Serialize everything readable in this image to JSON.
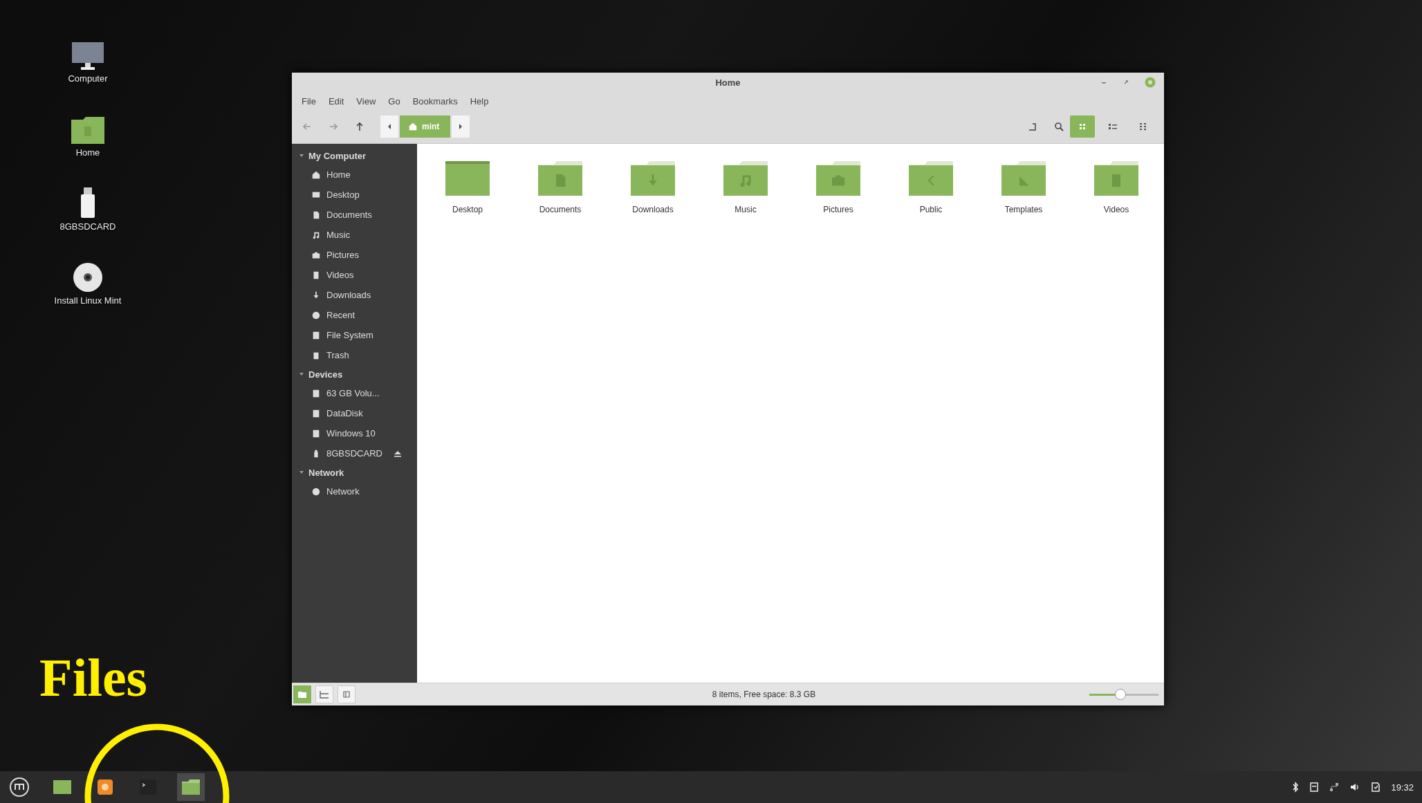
{
  "desktop_icons": [
    {
      "label": "Computer",
      "kind": "monitor"
    },
    {
      "label": "Home",
      "kind": "folder"
    },
    {
      "label": "8GBSDCARD",
      "kind": "usb"
    },
    {
      "label": "Install Linux Mint",
      "kind": "disc"
    }
  ],
  "window": {
    "title": "Home",
    "menu": [
      "File",
      "Edit",
      "View",
      "Go",
      "Bookmarks",
      "Help"
    ],
    "breadcrumb": "mint",
    "views": [
      {
        "kind": "icons",
        "selected": true
      },
      {
        "kind": "compact",
        "selected": false
      },
      {
        "kind": "list",
        "selected": false
      }
    ]
  },
  "sidebar": {
    "sections": [
      {
        "title": "My Computer",
        "expanded": true,
        "items": [
          {
            "label": "Home",
            "kind": "home",
            "ejectable": false
          },
          {
            "label": "Desktop",
            "kind": "desktop",
            "ejectable": false
          },
          {
            "label": "Documents",
            "kind": "document",
            "ejectable": false
          },
          {
            "label": "Music",
            "kind": "music",
            "ejectable": false
          },
          {
            "label": "Pictures",
            "kind": "camera",
            "ejectable": false
          },
          {
            "label": "Videos",
            "kind": "film",
            "ejectable": false
          },
          {
            "label": "Downloads",
            "kind": "download",
            "ejectable": false
          },
          {
            "label": "Recent",
            "kind": "clock",
            "ejectable": false
          },
          {
            "label": "File System",
            "kind": "drive",
            "ejectable": false
          },
          {
            "label": "Trash",
            "kind": "trash",
            "ejectable": false
          }
        ]
      },
      {
        "title": "Devices",
        "expanded": true,
        "items": [
          {
            "label": "63 GB Volu...",
            "kind": "drive",
            "ejectable": false
          },
          {
            "label": "DataDisk",
            "kind": "drive",
            "ejectable": false
          },
          {
            "label": "Windows 10",
            "kind": "drive",
            "ejectable": false
          },
          {
            "label": "8GBSDCARD",
            "kind": "usb",
            "ejectable": true
          }
        ]
      },
      {
        "title": "Network",
        "expanded": true,
        "items": [
          {
            "label": "Network",
            "kind": "globe",
            "ejectable": false
          }
        ]
      }
    ]
  },
  "folders": [
    {
      "label": "Desktop",
      "kind": "desktop"
    },
    {
      "label": "Documents",
      "kind": "document"
    },
    {
      "label": "Downloads",
      "kind": "download"
    },
    {
      "label": "Music",
      "kind": "music"
    },
    {
      "label": "Pictures",
      "kind": "camera"
    },
    {
      "label": "Public",
      "kind": "share"
    },
    {
      "label": "Templates",
      "kind": "template"
    },
    {
      "label": "Videos",
      "kind": "film"
    }
  ],
  "status_bar": {
    "panes": [
      {
        "kind": "places",
        "selected": true
      },
      {
        "kind": "tree",
        "selected": false
      },
      {
        "kind": "hide",
        "selected": false
      }
    ],
    "text": "8 items, Free space: 8.3 GB",
    "zoom": {
      "level": 0.45
    }
  },
  "annotation": {
    "label": "Files"
  },
  "taskbar": {
    "items": [
      {
        "kind": "menu",
        "selected": false
      },
      {
        "kind": "desktop",
        "selected": false
      },
      {
        "kind": "browser",
        "selected": false
      },
      {
        "kind": "terminal",
        "selected": false
      },
      {
        "kind": "files",
        "selected": true
      }
    ],
    "clock": "19:32"
  }
}
